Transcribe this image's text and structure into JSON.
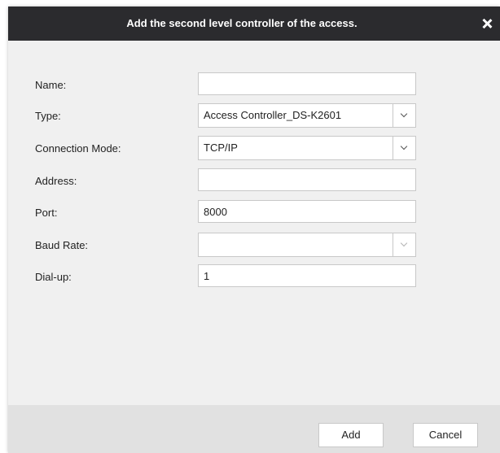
{
  "dialog": {
    "title": "Add the second level controller of the access.",
    "close_icon": "close-icon"
  },
  "form": {
    "name": {
      "label": "Name:",
      "value": ""
    },
    "type": {
      "label": "Type:",
      "value": "Access Controller_DS-K2601"
    },
    "connection_mode": {
      "label": "Connection Mode:",
      "value": "TCP/IP"
    },
    "address": {
      "label": "Address:",
      "value": ""
    },
    "port": {
      "label": "Port:",
      "value": "8000"
    },
    "baud_rate": {
      "label": "Baud Rate:",
      "value": "",
      "disabled": true
    },
    "dial_up": {
      "label": "Dial-up:",
      "value": "1"
    }
  },
  "footer": {
    "add_label": "Add",
    "cancel_label": "Cancel"
  },
  "colors": {
    "titlebar": "#2b2b2e",
    "body": "#f0f0f0",
    "footer": "#e1e1e1"
  }
}
